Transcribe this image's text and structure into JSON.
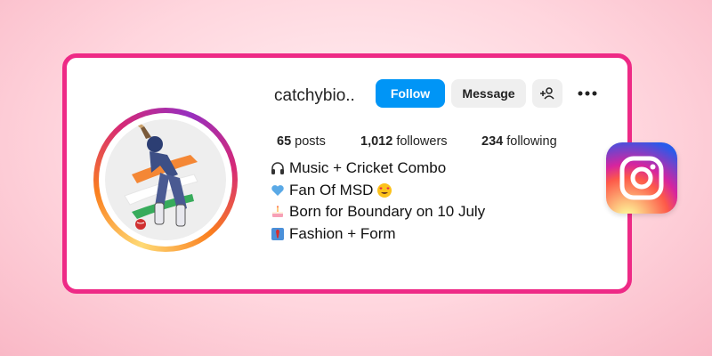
{
  "profile": {
    "username": "catchybio..",
    "follow_label": "Follow",
    "message_label": "Message",
    "posts_count": "65",
    "posts_label": "posts",
    "followers_count": "1,012",
    "followers_label": "followers",
    "following_count": "234",
    "following_label": "following"
  },
  "bio": [
    {
      "icon": "headphones-icon",
      "text": "Music + Cricket Combo"
    },
    {
      "icon": "blue-heart-icon",
      "text": "Fan Of MSD"
    },
    {
      "icon": "birthday-cake-icon",
      "text": "Born for Boundary on 10 July"
    },
    {
      "icon": "necktie-icon",
      "text": "Fashion + Form"
    }
  ],
  "colors": {
    "card_border": "#ee2a86",
    "follow_button": "#0095f6",
    "secondary_button": "#efefef"
  }
}
